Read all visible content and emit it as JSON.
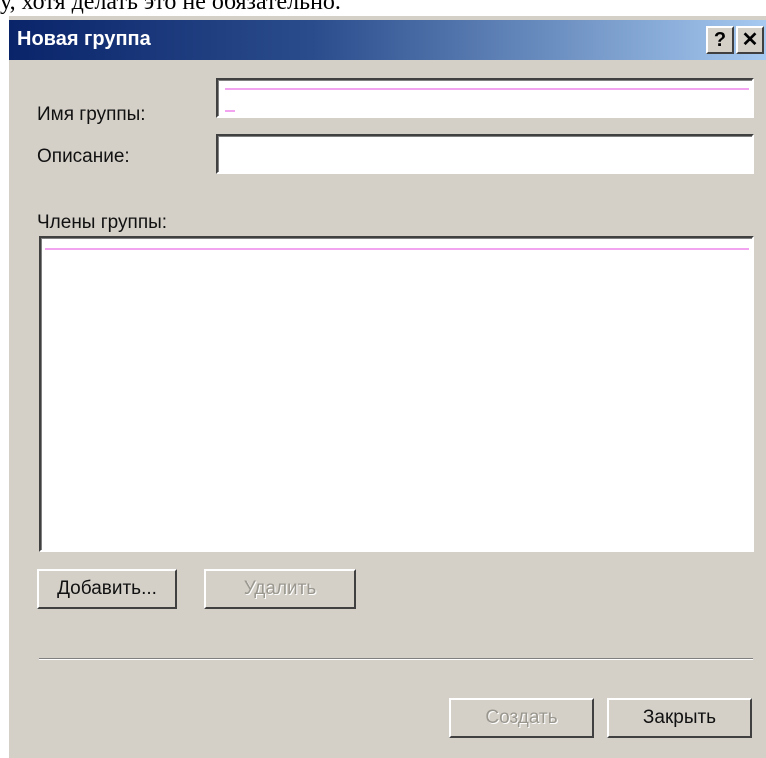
{
  "page": {
    "top_text": "у, хотя делать это не обязательно."
  },
  "dialog": {
    "title": "Новая группа",
    "help_symbol": "?",
    "close_symbol": "✕"
  },
  "form": {
    "group_name_label": "Имя группы:",
    "group_name_value": "",
    "description_label": "Описание:",
    "description_value": "",
    "members_label": "Члены группы:"
  },
  "buttons": {
    "add_label": "Добавить...",
    "remove_label": "Удалить",
    "create_label": "Создать",
    "close_label": "Закрыть"
  },
  "colors": {
    "titlebar_start": "#0a246a",
    "titlebar_end": "#a6caf0",
    "dialog_bg": "#d4d0c8",
    "disabled_text": "#9a978f"
  }
}
